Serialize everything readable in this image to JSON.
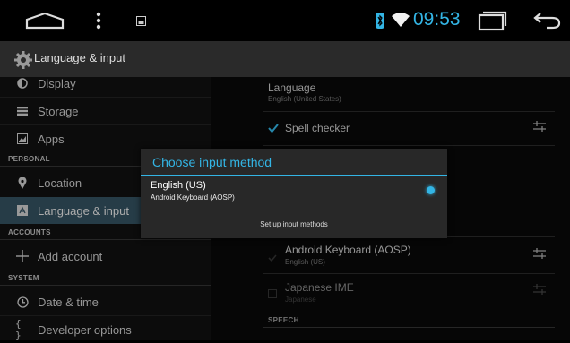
{
  "status": {
    "time": "09:53",
    "time_color": "#33b5e5",
    "icons": [
      "home-outline-icon",
      "menu-dots-icon",
      "screenshot-icon",
      "bluetooth-icon",
      "wifi-icon",
      "recents-icon",
      "back-icon"
    ]
  },
  "actionbar": {
    "title": "Language & input",
    "icon": "settings-gear-icon"
  },
  "sidebar": {
    "items": [
      {
        "label": "Display",
        "icon": "display-icon"
      },
      {
        "label": "Storage",
        "icon": "storage-icon"
      },
      {
        "label": "Apps",
        "icon": "apps-icon"
      },
      {
        "label": "Location",
        "icon": "location-icon"
      },
      {
        "label": "Language & input",
        "icon": "language-icon",
        "active": true
      },
      {
        "label": "Add account",
        "icon": "add-icon"
      },
      {
        "label": "Date & time",
        "icon": "clock-icon"
      },
      {
        "label": "Developer options",
        "icon": "code-icon"
      }
    ],
    "headers": {
      "personal": "PERSONAL",
      "accounts": "ACCOUNTS",
      "system": "SYSTEM"
    }
  },
  "content": {
    "language_title": "Language",
    "language_value": "English (United States)",
    "spell_checker": "Spell checker",
    "keyboard_aosp": "Android Keyboard (AOSP)",
    "keyboard_aosp_sub": "English (US)",
    "japanese_ime": "Japanese IME",
    "japanese_ime_sub": "Japanese",
    "speech_header": "SPEECH"
  },
  "dialog": {
    "title": "Choose input method",
    "option_title": "English (US)",
    "option_sub": "Android Keyboard (AOSP)",
    "setup_label": "Set up input methods",
    "accent": "#33b5e5"
  }
}
